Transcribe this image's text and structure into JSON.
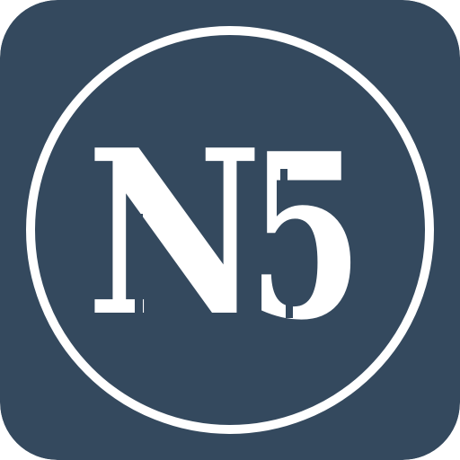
{
  "app_icon": {
    "logo_text": {
      "letter": "N",
      "digit": "5"
    },
    "colors": {
      "background": "#34495e",
      "foreground": "#ffffff"
    },
    "icon": "n5-logo-icon"
  }
}
